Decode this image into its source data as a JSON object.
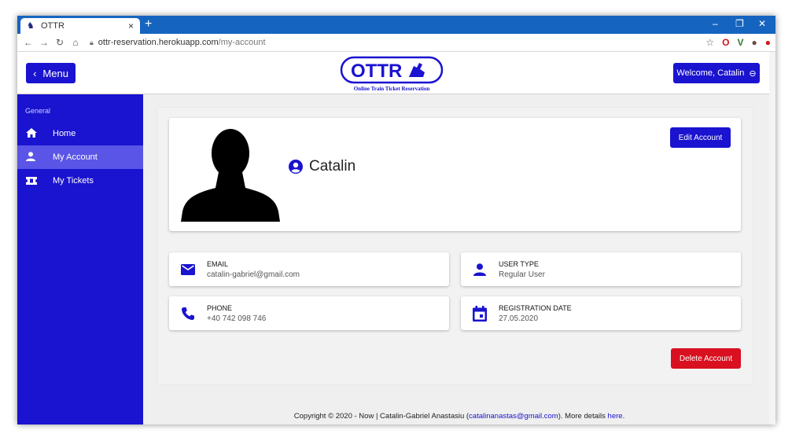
{
  "browser": {
    "tab_title": "OTTR",
    "tab_close": "×",
    "new_tab": "+",
    "url_host": "ottr-reservation.herokuapp.com",
    "url_path": "/my-account"
  },
  "header": {
    "menu_label": "Menu",
    "logo_text": "OTTR",
    "logo_subtitle": "Online Train Ticket Reservation",
    "welcome_label": "Welcome, Catalin"
  },
  "sidebar": {
    "heading": "General",
    "items": [
      {
        "label": "Home",
        "icon": "home-icon",
        "active": false
      },
      {
        "label": "My Account",
        "icon": "user-icon",
        "active": true
      },
      {
        "label": "My Tickets",
        "icon": "ticket-icon",
        "active": false
      }
    ]
  },
  "profile": {
    "name": "Catalin",
    "edit_label": "Edit Account"
  },
  "info": {
    "email_label": "EMAIL",
    "email_value": "catalin-gabriel@gmail.com",
    "user_type_label": "USER TYPE",
    "user_type_value": "Regular User",
    "phone_label": "PHONE",
    "phone_value": "+40 742 098 746",
    "registration_label": "REGISTRATION DATE",
    "registration_value": "27.05.2020"
  },
  "actions": {
    "delete_label": "Delete Account"
  },
  "footer": {
    "text_before": "Copyright © 2020 - Now | Catalin-Gabriel Anastasiu (",
    "email_link": "catalinanastas@gmail.com",
    "text_middle": "). More details ",
    "here_link": "here",
    "text_after": "."
  },
  "colors": {
    "primary": "#1a13cf",
    "sidebar_active": "#5a55e6",
    "danger": "#d9101f",
    "browser_bar": "#1565c0"
  }
}
